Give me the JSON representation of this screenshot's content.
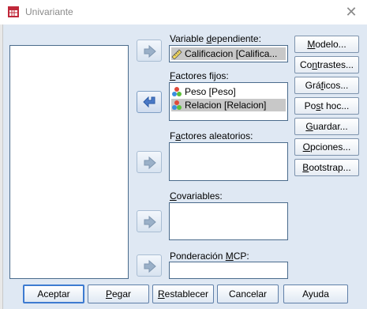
{
  "window": {
    "title": "Univariante"
  },
  "dependent": {
    "label_pre": "Variable ",
    "label_ul": "d",
    "label_post": "ependiente:",
    "value": "Calificacion [Califica..."
  },
  "fixed": {
    "label_pre": "",
    "label_ul": "F",
    "label_post": "actores fijos:",
    "items": [
      "Peso [Peso]",
      "Relacion [Relacion]"
    ]
  },
  "random": {
    "label_pre": "F",
    "label_ul": "a",
    "label_post": "ctores aleatorios:"
  },
  "covariates": {
    "label_pre": "",
    "label_ul": "C",
    "label_post": "ovariables:"
  },
  "wls": {
    "label_pre": "Ponderación ",
    "label_ul": "M",
    "label_post": "CP:"
  },
  "side_buttons": [
    {
      "pre": "",
      "ul": "M",
      "post": "odelo..."
    },
    {
      "pre": "Co",
      "ul": "n",
      "post": "trastes..."
    },
    {
      "pre": "Grá",
      "ul": "f",
      "post": "icos..."
    },
    {
      "pre": "Po",
      "ul": "s",
      "post": "t hoc..."
    },
    {
      "pre": "",
      "ul": "G",
      "post": "uardar..."
    },
    {
      "pre": "",
      "ul": "O",
      "post": "pciones..."
    },
    {
      "pre": "",
      "ul": "B",
      "post": "ootstrap..."
    }
  ],
  "bottom_buttons": [
    {
      "pre": "Aceptar",
      "ul": "",
      "post": ""
    },
    {
      "pre": "",
      "ul": "P",
      "post": "egar"
    },
    {
      "pre": "",
      "ul": "R",
      "post": "establecer"
    },
    {
      "pre": "Cancelar",
      "ul": "",
      "post": ""
    },
    {
      "pre": "Ayuda",
      "ul": "",
      "post": ""
    }
  ],
  "colors": {
    "dialog_bg": "#dfe8f3",
    "accent": "#3d7bd1",
    "selection": "#c8c8c8"
  }
}
